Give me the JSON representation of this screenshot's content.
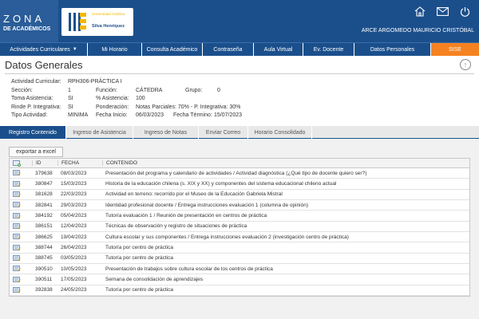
{
  "brand": {
    "title": "ZONA",
    "subtitle": "DE ACADÉMICOS",
    "university_line1": "Universidad Católica",
    "university_line2": "Silva Henríquez",
    "colors": {
      "primary": "#1b4f8c",
      "accent": "#f58220",
      "logo_gold": "#f2b705"
    }
  },
  "header": {
    "icons": [
      "home-icon",
      "mail-icon",
      "power-icon"
    ],
    "user_name": "ARCE ARGOMEDO MAURICIO CRISTÓBAL"
  },
  "nav": {
    "items": [
      {
        "label": "Actividades Curriculares",
        "has_dropdown": true
      },
      {
        "label": "Mi Horario"
      },
      {
        "label": "Consulta Académico"
      },
      {
        "label": "Contraseña"
      },
      {
        "label": "Aula Virtual"
      },
      {
        "label": "Ev. Docente"
      },
      {
        "label": "Datos Personales"
      },
      {
        "label": "SISE",
        "active": true
      }
    ]
  },
  "page": {
    "title": "Datos Generales"
  },
  "info": {
    "actividad_label": "Actividad Curricular:",
    "actividad_value": "RPH306-PRÁCTICA I",
    "seccion_label": "Sección:",
    "seccion_value": "1",
    "funcion_label": "Función:",
    "funcion_value": "CÁTEDRA",
    "grupo_label": "Grupo:",
    "grupo_value": "0",
    "toma_label": "Toma Asistencia:",
    "toma_value": "SI",
    "asistencia_label": "% Asistencia:",
    "asistencia_value": "100",
    "rinde_label": "Rinde P. Integrativa:",
    "rinde_value": "SI",
    "ponderacion_label": "Ponderación:",
    "ponderacion_value": "Notas Parciales: 70% - P. Integrativa: 30%",
    "tipo_label": "Tipo Actividad:",
    "tipo_value": "MINIMA",
    "inicio_label": "Fecha Inicio:",
    "inicio_value": "06/03/2023",
    "termino_label": "Fecha Término:",
    "termino_value": "15/07/2023"
  },
  "tabs": [
    {
      "label": "Registro Contenido",
      "active": true
    },
    {
      "label": "Ingreso de Asistencia"
    },
    {
      "label": "Ingreso de Notas"
    },
    {
      "label": "Enviar Correo"
    },
    {
      "label": "Horario Consolidado"
    }
  ],
  "export_label": "exportar a excel",
  "table": {
    "headers": {
      "id": "ID",
      "fecha": "FECHA",
      "contenido": "CONTENIDO"
    },
    "rows": [
      {
        "id": "379638",
        "fecha": "08/03/2023",
        "contenido": "Presentación del programa y calendario de actividades / Actividad diagnóstica (¿Qué tipo de docente quiero ser?)"
      },
      {
        "id": "380847",
        "fecha": "15/03/2023",
        "contenido": "Historia de la educación chilena (s. XIX y XX) y componentes del sistema educacional chileno actual"
      },
      {
        "id": "381628",
        "fecha": "22/03/2023",
        "contenido": "Actividad en terreno: recorrido por el Museo de la Educación Gabriela Mistral"
      },
      {
        "id": "382841",
        "fecha": "29/03/2023",
        "contenido": "Identidad profesional docente / Entrega instrucciones evaluación 1 (columna de opinión)"
      },
      {
        "id": "384192",
        "fecha": "05/04/2023",
        "contenido": "Tutoría evaluación 1 / Reunión de presentación en centros de práctica"
      },
      {
        "id": "386151",
        "fecha": "12/04/2023",
        "contenido": "Técnicas de observación y registro de situaciones de práctica"
      },
      {
        "id": "386625",
        "fecha": "19/04/2023",
        "contenido": "Cultura escolar y sus componentes / Entrega instrucciones evaluación 2 (investigación centro de práctica)"
      },
      {
        "id": "388744",
        "fecha": "26/04/2023",
        "contenido": "Tutoría por centro de práctica"
      },
      {
        "id": "388745",
        "fecha": "03/05/2023",
        "contenido": "Tutoría por centro de práctica"
      },
      {
        "id": "390510",
        "fecha": "10/05/2023",
        "contenido": "Presentación de trabajos sobre cultura escolar de los centros de práctica"
      },
      {
        "id": "390511",
        "fecha": "17/05/2023",
        "contenido": "Semana de consolidación de aprendizajes"
      },
      {
        "id": "392838",
        "fecha": "24/05/2023",
        "contenido": "Tutoría por centro de práctica"
      }
    ]
  }
}
